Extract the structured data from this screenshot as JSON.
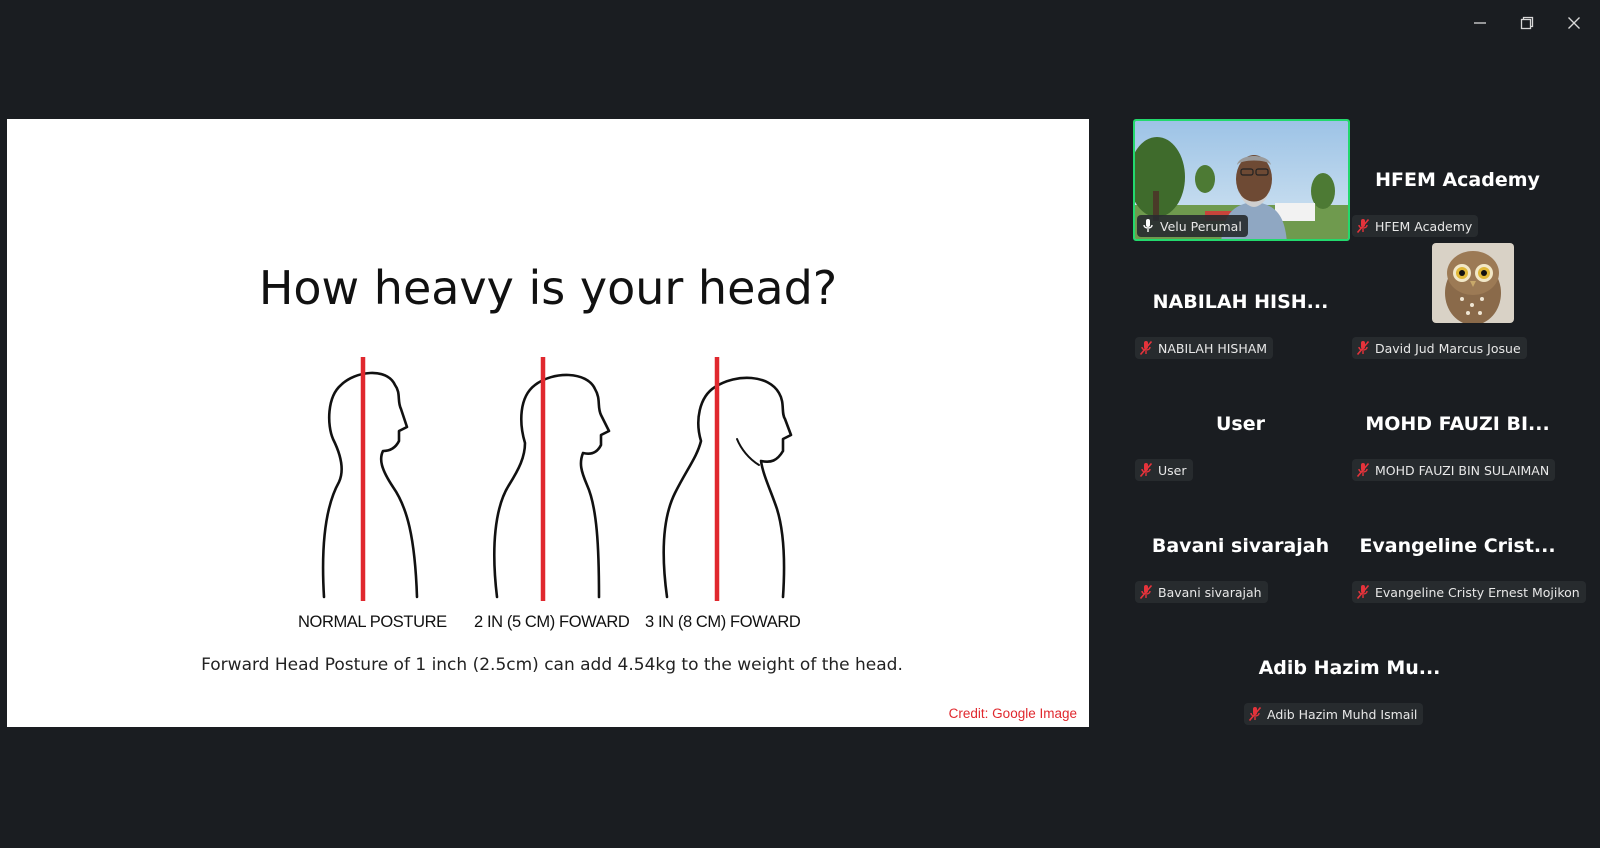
{
  "window": {
    "controls": [
      "minimize",
      "restore",
      "close"
    ]
  },
  "slide": {
    "title": "How heavy is your head?",
    "figure_labels": [
      "NORMAL POSTURE",
      "2 IN (5 CM) FOWARD",
      "3 IN (8 CM) FOWARD"
    ],
    "caption": "Forward Head Posture of 1 inch (2.5cm) can add 4.54kg to the weight of the head.",
    "credit": "Credit: Google Image",
    "credit_color": "#e0282e",
    "line_color": "#e0282e"
  },
  "participants": [
    {
      "display": "",
      "label": "Velu Perumal",
      "video": true,
      "active_speaker": true,
      "mic": "speaking"
    },
    {
      "display": "HFEM Academy",
      "label": "HFEM Academy",
      "mic": "muted"
    },
    {
      "display": "NABILAH  HISH...",
      "label": "NABILAH HISHAM",
      "mic": "muted"
    },
    {
      "display": "",
      "label": "David Jud Marcus Josue",
      "avatar": "owl",
      "mic": "muted"
    },
    {
      "display": "User",
      "label": "User",
      "mic": "muted"
    },
    {
      "display": "MOHD  FAUZI  BI...",
      "label": "MOHD FAUZI BIN SULAIMAN",
      "mic": "muted"
    },
    {
      "display": "Bavani sivarajah",
      "label": "Bavani sivarajah",
      "mic": "muted"
    },
    {
      "display": "Evangeline  Crist...",
      "label": "Evangeline Cristy Ernest Mojikon",
      "mic": "muted"
    },
    {
      "display": "Adib  Hazim  Mu...",
      "label": "Adib Hazim Muhd Ismail",
      "mic": "muted"
    }
  ],
  "colors": {
    "background": "#1a1d21",
    "active_speaker_border": "#23d96d",
    "muted_icon": "#e5333b"
  }
}
